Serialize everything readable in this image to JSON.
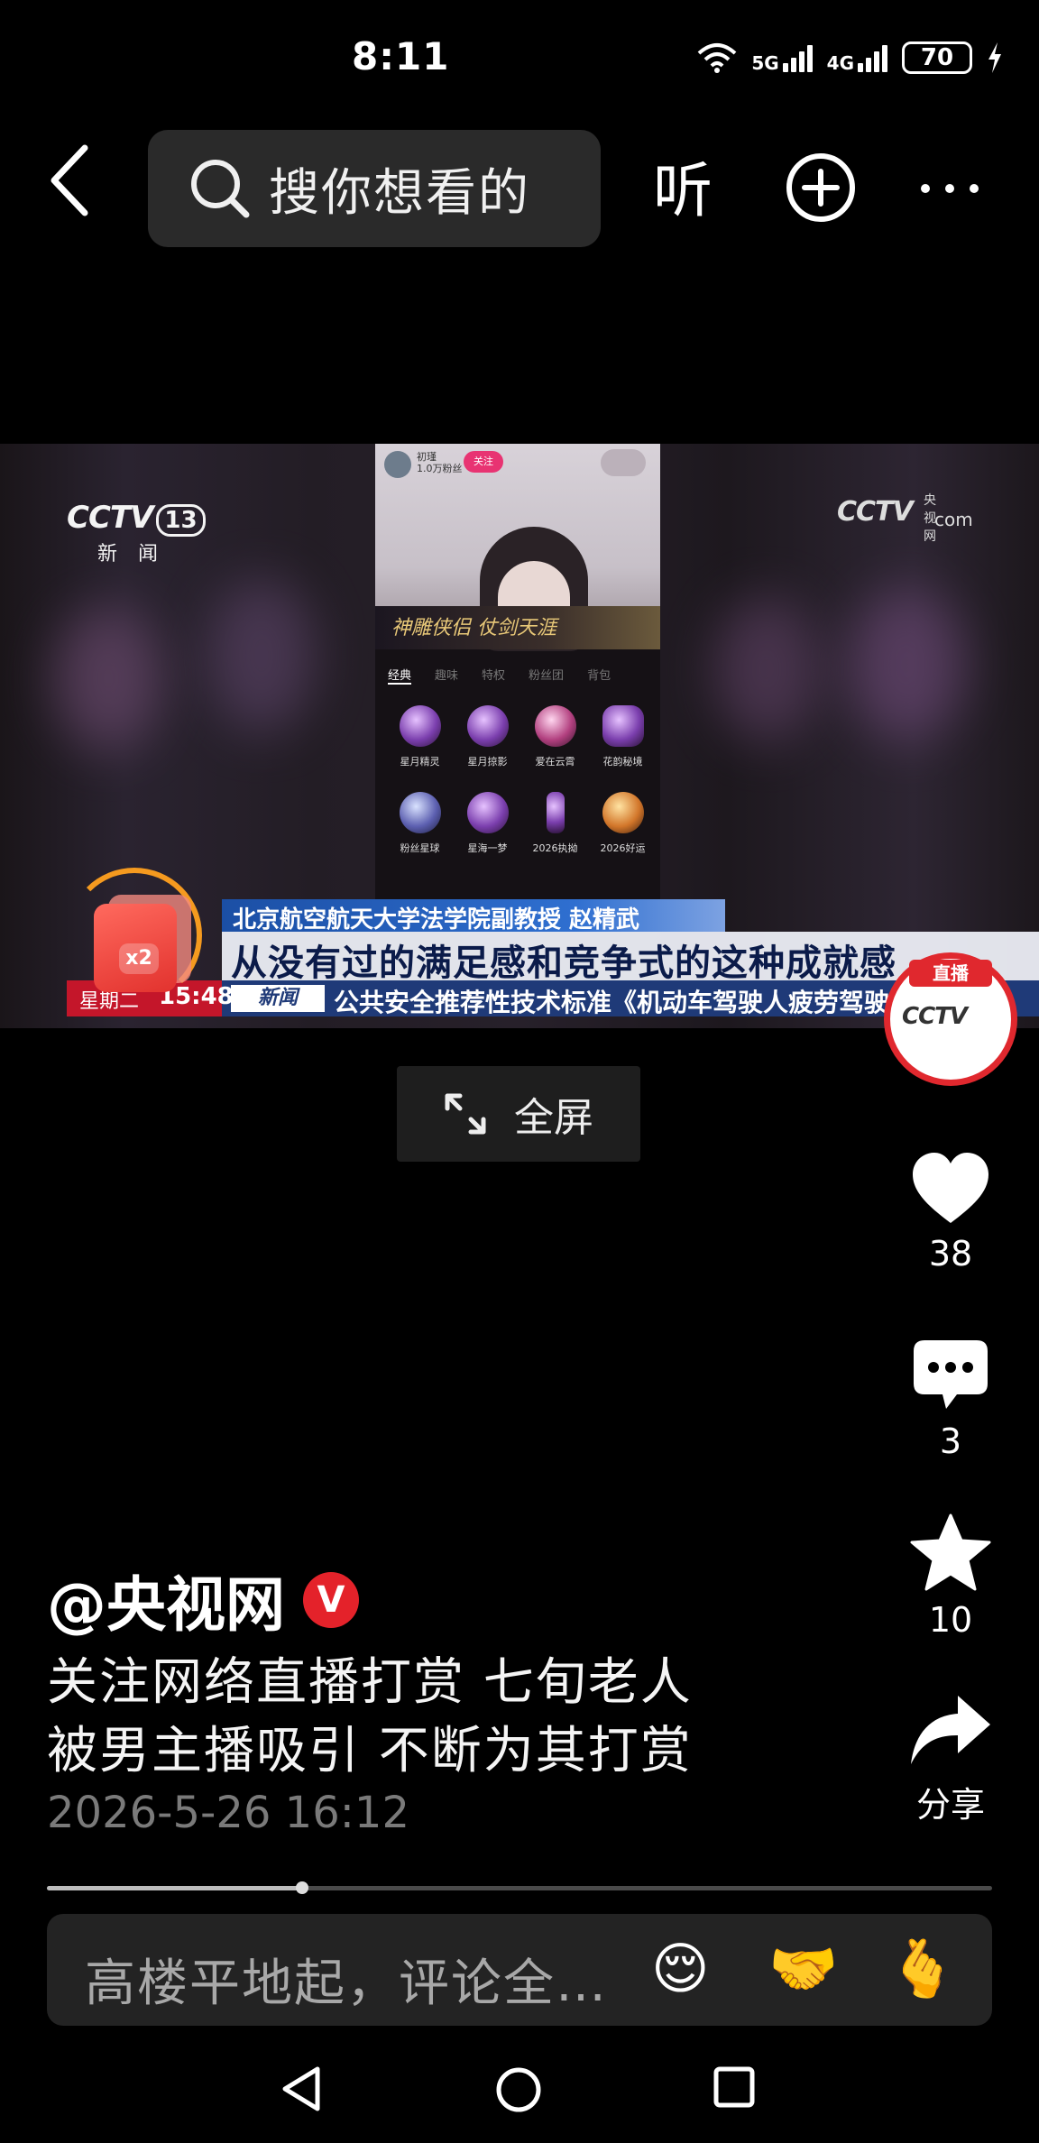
{
  "status_bar": {
    "time": "8:11",
    "network_1": "5G",
    "network_2": "4G",
    "battery": "70"
  },
  "top_bar": {
    "search_placeholder": "搜你想看的",
    "listen_label": "听"
  },
  "video": {
    "channel_logo": "CCTV",
    "channel_number": "13",
    "channel_subtitle": "新 闻",
    "site_logo": "CCTV",
    "site_logo_small": "央视网",
    "site_logo_com": "com",
    "phone_banner": "神雕侠侣 仗剑天涯",
    "phone_follow": "关注",
    "phone_name": "初瑾",
    "phone_fans": "1.0万粉丝",
    "phone_tabs": [
      "经典",
      "趣味",
      "特权",
      "粉丝团",
      "背包"
    ],
    "gifts": [
      "星月精灵",
      "星月掠影",
      "爱在云霄",
      "花韵秘境",
      "粉丝星球",
      "星海一梦",
      "2026执拗",
      "2026好运"
    ],
    "name_caption": "北京航空航天大学法学院副教授 赵精武",
    "subtitle": "从没有过的满足感和竞争式的这种成就感",
    "ticker_day": "星期二",
    "ticker_time": "15:48",
    "ticker_logo": "新闻",
    "ticker_text": "公共安全推荐性技术标准《机动车驾驶人疲劳驾驶判定规则》",
    "redpacket_label": "x2",
    "live_label": "直播",
    "live_logo": "CCTV"
  },
  "fullscreen_label": "全屏",
  "actions": {
    "likes": "38",
    "comments": "3",
    "favorites": "10",
    "share_label": "分享"
  },
  "post": {
    "author": "@央视网",
    "verified_mark": "V",
    "caption_line1": "关注网络直播打赏 七旬老人",
    "caption_line2": "被男主播吸引 不断为其打赏",
    "time": "2026-5-26 16:12",
    "progress": 0.27
  },
  "comment_bar": {
    "placeholder": "高楼平地起，评论全…",
    "emoji_1": "😌",
    "emoji_2": "🤝",
    "emoji_3": "🫰"
  },
  "icons": {
    "back": "back-icon",
    "search": "search-icon",
    "add": "add-circle-icon",
    "more": "more-icon",
    "fullscreen": "expand-icon",
    "like": "heart-icon",
    "comment": "comment-icon",
    "favorite": "star-icon",
    "share": "share-arrow-icon"
  },
  "colors": {
    "background": "#000000",
    "verified": "#e4222a",
    "live_badge": "#e0282e",
    "news_bar": "#1f3a78"
  }
}
